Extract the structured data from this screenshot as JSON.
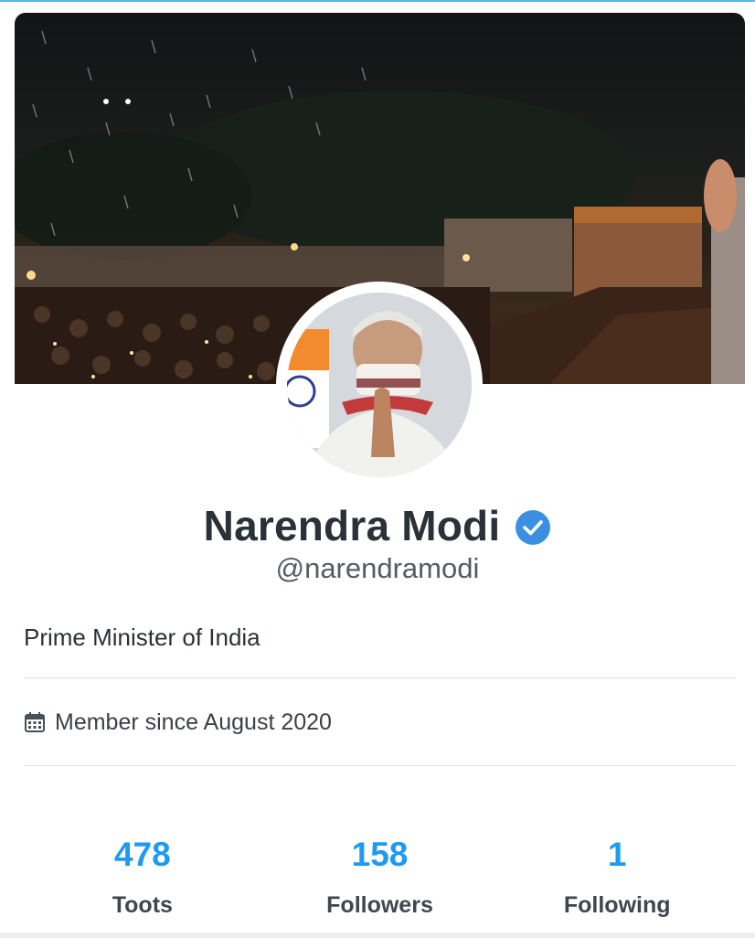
{
  "profile": {
    "display_name": "Narendra Modi",
    "handle": "@narendramodi",
    "verified": true,
    "bio": "Prime Minister of India",
    "member_since": "Member since August 2020",
    "header_image": "rally-crowd-night-photo",
    "avatar_image": "profile-photo-namaste"
  },
  "stats": [
    {
      "value": "478",
      "label": "Toots"
    },
    {
      "value": "158",
      "label": "Followers"
    },
    {
      "value": "1",
      "label": "Following"
    }
  ],
  "icons": {
    "verified": "verified-check-icon",
    "calendar": "calendar-icon"
  },
  "colors": {
    "accent": "#1d9bf0",
    "verified_badge": "#3b8fe0",
    "text_primary": "#2b3138",
    "text_secondary": "#555b63"
  }
}
